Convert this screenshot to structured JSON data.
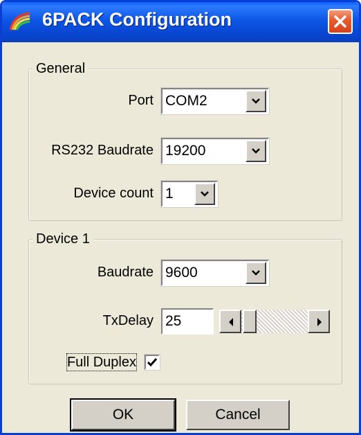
{
  "window": {
    "title": "6PACK Configuration"
  },
  "icons": {
    "app": "rainbow-arc-icon",
    "close": "close-icon",
    "dropdown": "chevron-down-icon",
    "scroll_left": "arrow-left-icon",
    "scroll_right": "arrow-right-icon",
    "check": "checkmark-icon"
  },
  "general": {
    "title": "General",
    "port": {
      "label": "Port",
      "value": "COM2"
    },
    "baudrate": {
      "label": "RS232 Baudrate",
      "value": "19200"
    },
    "device_count": {
      "label": "Device count",
      "value": "1"
    }
  },
  "device": {
    "title": "Device 1",
    "baudrate": {
      "label": "Baudrate",
      "value": "9600"
    },
    "txdelay": {
      "label": "TxDelay",
      "value": "25"
    },
    "full_duplex": {
      "label": "Full Duplex",
      "checked": true
    }
  },
  "buttons": {
    "ok": "OK",
    "cancel": "Cancel"
  },
  "colors": {
    "titlebar": "#0A3FD3",
    "dialog_bg": "#ECE9D8",
    "close": "#E55B2E"
  }
}
